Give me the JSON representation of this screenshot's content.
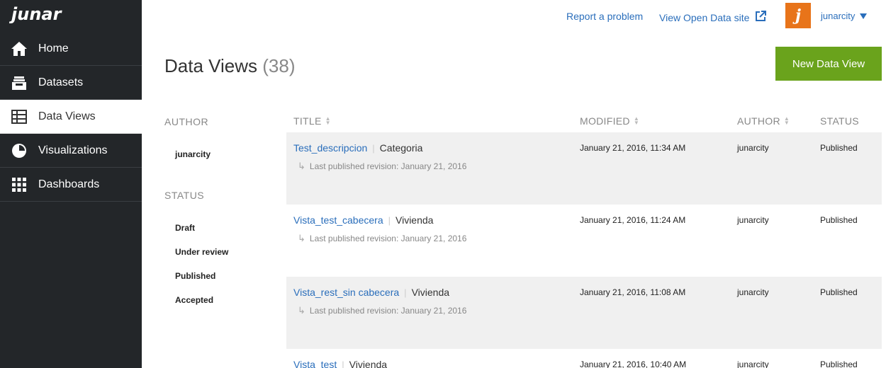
{
  "app": {
    "logo_text": "junar"
  },
  "sidebar": {
    "items": [
      {
        "label": "Home",
        "icon": "home-icon",
        "active": false
      },
      {
        "label": "Datasets",
        "icon": "inbox-tray-icon",
        "active": false
      },
      {
        "label": "Data Views",
        "icon": "table-icon",
        "active": true
      },
      {
        "label": "Visualizations",
        "icon": "pie-chart-icon",
        "active": false
      },
      {
        "label": "Dashboards",
        "icon": "grid-icon",
        "active": false
      }
    ]
  },
  "topbar": {
    "report_label": "Report a problem",
    "open_data_label": "View Open Data site",
    "username": "junarcity",
    "avatar_letter": "j"
  },
  "header": {
    "title": "Data Views",
    "count": "(38)",
    "new_button_label": "New Data View"
  },
  "filters": {
    "author_heading": "AUTHOR",
    "authors": [
      "junarcity"
    ],
    "status_heading": "STATUS",
    "statuses": [
      "Draft",
      "Under review",
      "Published",
      "Accepted"
    ]
  },
  "table": {
    "columns": {
      "title": "TITLE",
      "modified": "MODIFIED",
      "author": "AUTHOR",
      "status": "STATUS"
    },
    "rows": [
      {
        "title": "Test_descripcion",
        "category": "Categoria",
        "revision": "Last published revision: January 21, 2016",
        "modified": "January 21, 2016, 11:34 AM",
        "author": "junarcity",
        "status": "Published"
      },
      {
        "title": "Vista_test_cabecera",
        "category": "Vivienda",
        "revision": "Last published revision: January 21, 2016",
        "modified": "January 21, 2016, 11:24 AM",
        "author": "junarcity",
        "status": "Published"
      },
      {
        "title": "Vista_rest_sin cabecera",
        "category": "Vivienda",
        "revision": "Last published revision: January 21, 2016",
        "modified": "January 21, 2016, 11:08 AM",
        "author": "junarcity",
        "status": "Published"
      },
      {
        "title": "Vista_test",
        "category": "Vivienda",
        "revision": "",
        "modified": "January 21, 2016, 10:40 AM",
        "author": "junarcity",
        "status": "Published"
      }
    ]
  },
  "colors": {
    "sidebar_bg": "#232629",
    "accent_green": "#6aa31c",
    "link_blue": "#2a6ebb",
    "row_shade": "#f0f0f0",
    "avatar_orange": "#e8741a"
  }
}
